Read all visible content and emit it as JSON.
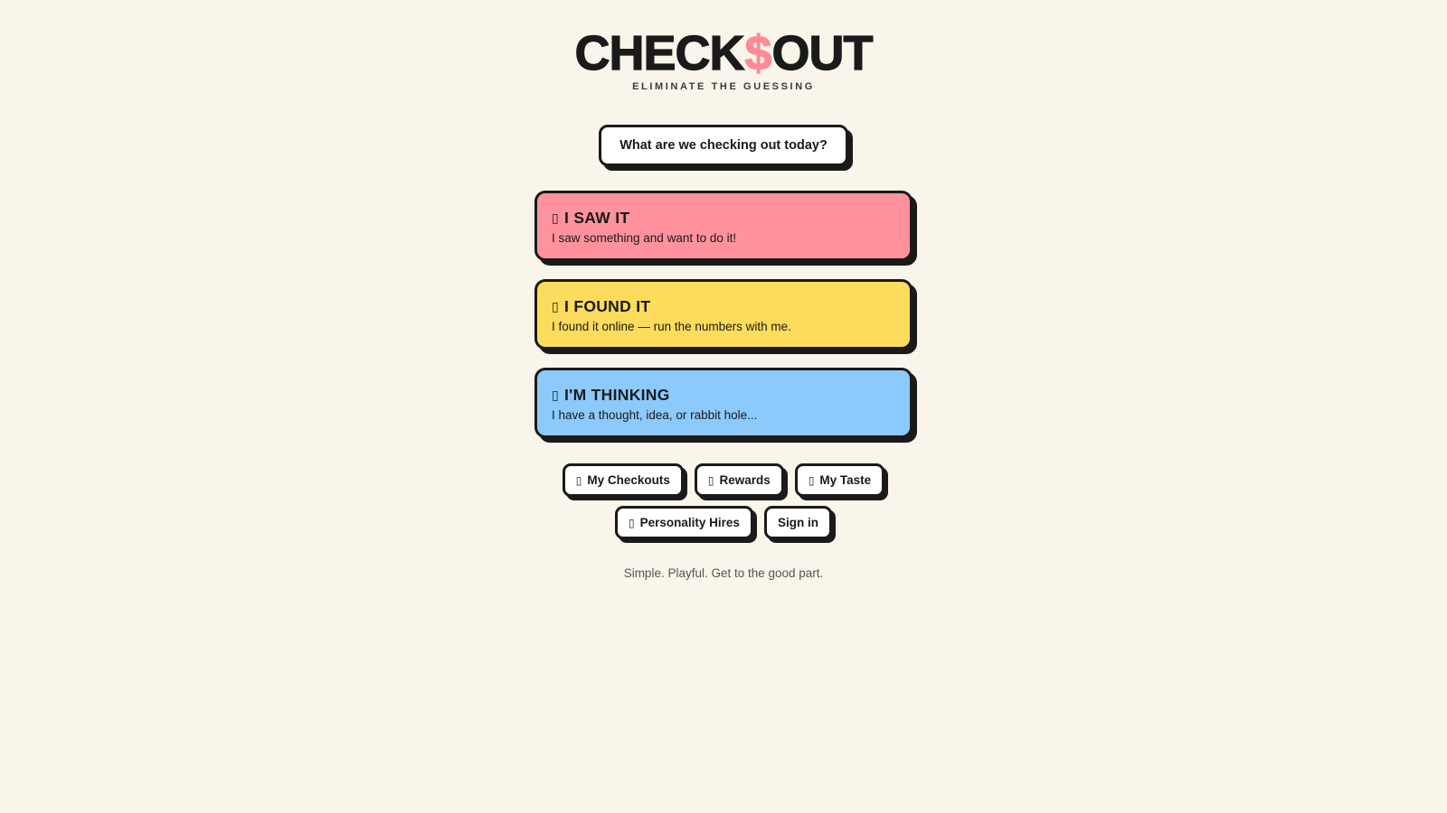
{
  "brand": {
    "logo_left": "CHECK",
    "logo_symbol": "$",
    "logo_right": "OUT",
    "tagline": "ELIMINATE THE GUESSING",
    "accent_color": "#ff8a95"
  },
  "prompt_button": {
    "label": "What are we checking out today?"
  },
  "options": [
    {
      "icon": "eye-icon",
      "icon_glyph": "▯",
      "title": "I SAW IT",
      "description": "I saw something and want to do it!",
      "color": "#ff929c"
    },
    {
      "icon": "search-icon",
      "icon_glyph": "▯",
      "title": "I FOUND IT",
      "description": "I found it online — run the numbers with me.",
      "color": "#fcdc5c"
    },
    {
      "icon": "thought-icon",
      "icon_glyph": "▯",
      "title": "I'M THINKING",
      "description": "I have a thought, idea, or rabbit hole...",
      "color": "#8ccafc"
    }
  ],
  "nav": {
    "my_checkouts": {
      "icon": "checklist-icon",
      "icon_glyph": "▯",
      "label": "My Checkouts"
    },
    "rewards": {
      "icon": "gift-icon",
      "icon_glyph": "▯",
      "label": "Rewards"
    },
    "my_taste": {
      "icon": "sparkle-icon",
      "icon_glyph": "▯",
      "label": "My Taste"
    },
    "personality_hires": {
      "icon": "person-icon",
      "icon_glyph": "▯",
      "label": "Personality Hires"
    },
    "sign_in": {
      "label": "Sign in"
    }
  },
  "footer": {
    "text": "Simple. Playful. Get to the good part."
  }
}
